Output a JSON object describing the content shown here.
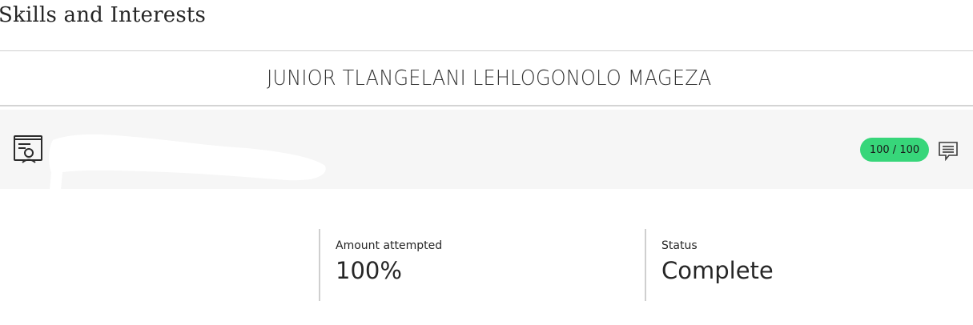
{
  "page": {
    "title": "Skills and Interests"
  },
  "student": {
    "name": "JUNIOR TLANGELANI LEHLOGONOLO MAGEZA"
  },
  "grade_row": {
    "item_icon": "certificate-icon",
    "score": "100 / 100",
    "score_color": "#37d67a",
    "feedback_icon": "feedback-comment-icon"
  },
  "stats": {
    "attempted_label": "Amount attempted",
    "attempted_value": "100%",
    "status_label": "Status",
    "status_value": "Complete"
  }
}
